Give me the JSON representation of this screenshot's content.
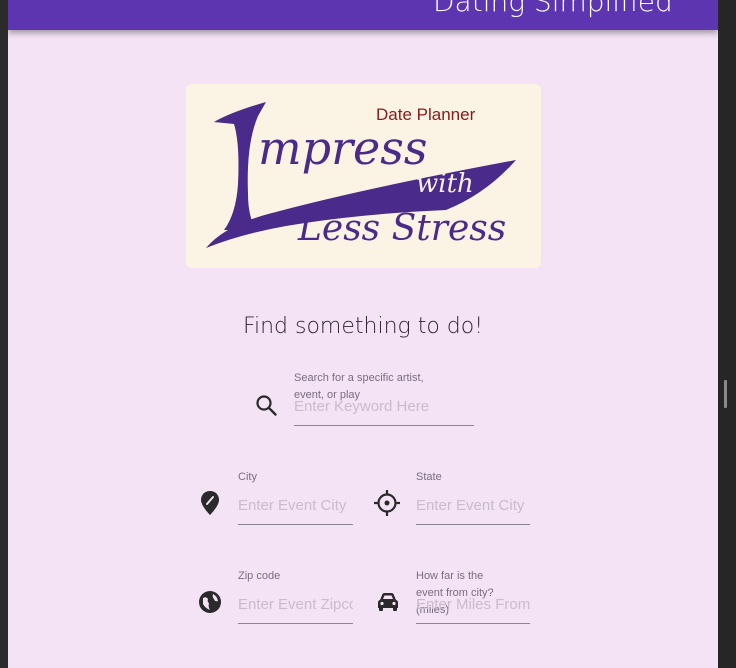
{
  "app": {
    "title": "Dating Simplified"
  },
  "logo": {
    "small_text": "Date Planner",
    "line1": "mpress",
    "line2": "with",
    "line3": "Less Stress"
  },
  "search": {
    "heading": "Find something to do!",
    "keyword": {
      "label": "Search for a specific artist, event, or play",
      "placeholder": "Enter Keyword Here",
      "icon": "search-icon"
    },
    "city": {
      "label": "City",
      "placeholder": "Enter Event City",
      "icon": "location-pin-icon"
    },
    "state": {
      "label": "State",
      "placeholder": "Enter Event City",
      "icon": "gps-target-icon"
    },
    "zip": {
      "label": "Zip code",
      "placeholder": "Enter Event Zipcode",
      "icon": "globe-icon"
    },
    "distance": {
      "label": "How far is the event from city? (miles)",
      "placeholder": "Enter Miles From City",
      "icon": "car-icon"
    }
  },
  "colors": {
    "appbar": "#5e35b1",
    "page_background": "#f3e3f5",
    "logo_purple": "#4a2a8a",
    "logo_red": "#8b1a1a",
    "logo_background": "#fbf3e4"
  }
}
